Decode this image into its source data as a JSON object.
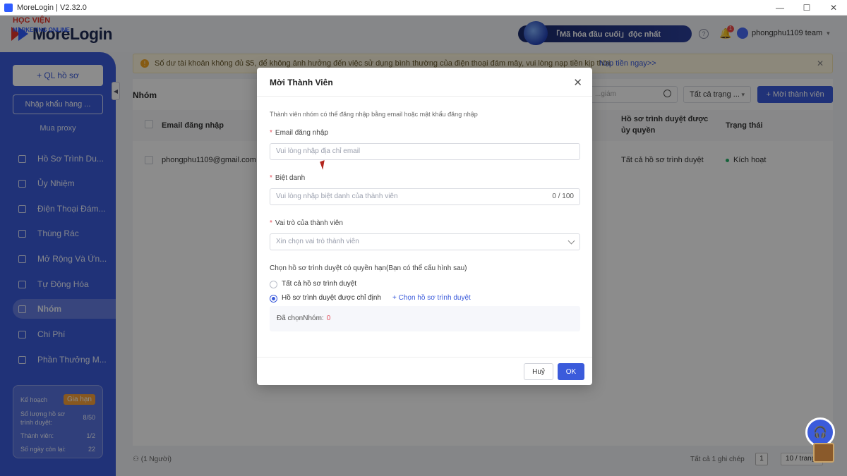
{
  "window": {
    "title": "MoreLogin | V2.32.0",
    "controls": [
      "—",
      "☐",
      "✕"
    ]
  },
  "header": {
    "app_name": "MoreLogin",
    "watermark_line1": "HỌC VIỆN",
    "watermark_line2": "MARKETING ONLINE",
    "encrypt_label": "「Mã hóa đầu cuối」độc nhất",
    "notification_count": "1",
    "team_name": "phongphu1109 team"
  },
  "sidebar": {
    "ql_button": "+ QL hồ sơ",
    "import_button": "Nhập khẩu hàng ...",
    "buy_proxy": "Mua proxy",
    "items": [
      {
        "label": "Hồ Sơ Trình Du...",
        "icon": "browser-profile-icon"
      },
      {
        "label": "Ủy Nhiệm",
        "icon": "proxy-icon"
      },
      {
        "label": "Điện Thoại Đám...",
        "icon": "cloud-phone-icon"
      },
      {
        "label": "Thùng Rác",
        "icon": "trash-icon"
      },
      {
        "label": "Mở Rộng Và Ứn...",
        "icon": "extension-icon"
      },
      {
        "label": "Tự Động Hóa",
        "icon": "automation-icon"
      },
      {
        "label": "Nhóm",
        "icon": "team-icon",
        "active": true
      },
      {
        "label": "Chi Phí",
        "icon": "billing-icon"
      },
      {
        "label": "Phần Thưởng M...",
        "icon": "reward-icon"
      }
    ],
    "plan": {
      "label": "Kế hoạch",
      "renew_button": "Gia hạn",
      "profiles_label": "Số lượng hồ sơ trình duyệt:",
      "profiles_value": "8/50",
      "members_label": "Thành viên:",
      "members_value": "1/2",
      "days_label": "Số ngày còn lại:",
      "days_value": "22"
    }
  },
  "notice": {
    "text": "Số dư tài khoản không đủ $5, để không ảnh hưởng đến việc sử dụng bình thường của điện thoại đám mây, vui lòng nạp tiền kịp thời.",
    "link": "Nạp tiền ngay>>"
  },
  "main": {
    "title": "Nhóm",
    "search_placeholder": "...giám",
    "status_filter": "Tất cả trạng ...",
    "new_member_button": "+ Mời thành viên",
    "columns": {
      "email": "Email đăng nhập",
      "profiles": "Hồ sơ trình duyệt được ủy quyền",
      "status": "Trạng thái"
    },
    "rows": [
      {
        "email": "phongphu1109@gmail.com",
        "profiles": "Tất cả hồ sơ trình duyệt",
        "status": "Kích hoạt"
      }
    ],
    "footer_count": "(1 Người)",
    "footer_total": "Tất cả 1 ghi chép",
    "page": "1",
    "per_page": "10 / trang"
  },
  "modal": {
    "title": "Mời Thành Viên",
    "description": "Thành viên nhóm có thể đăng nhập bằng email hoặc mật khẩu đăng nhập",
    "email_label": "Email đăng nhập",
    "email_placeholder": "Vui lòng nhập địa chỉ email",
    "nickname_label": "Biệt danh",
    "nickname_placeholder": "Vui lòng nhập biệt danh của thành viên",
    "nickname_counter": "0 / 100",
    "role_label": "Vai trò của thành viên",
    "role_placeholder": "Xin chọn vai trò thành viên",
    "scope_label": "Chọn hồ sơ trình duyệt có quyền hạn(Bạn có thể cấu hình sau)",
    "scope_all": "Tất cả hồ sơ trình duyệt",
    "scope_specified": "Hồ sơ trình duyệt được chỉ định",
    "pick_link": "+ Chọn hồ sơ trình duyệt",
    "selected_label": "Đã chọnNhóm:",
    "selected_count": "0",
    "cancel": "Huỷ",
    "ok": "OK"
  },
  "colors": {
    "accent": "#3b5bdb",
    "danger": "#e34d59",
    "success": "#27b36b"
  }
}
